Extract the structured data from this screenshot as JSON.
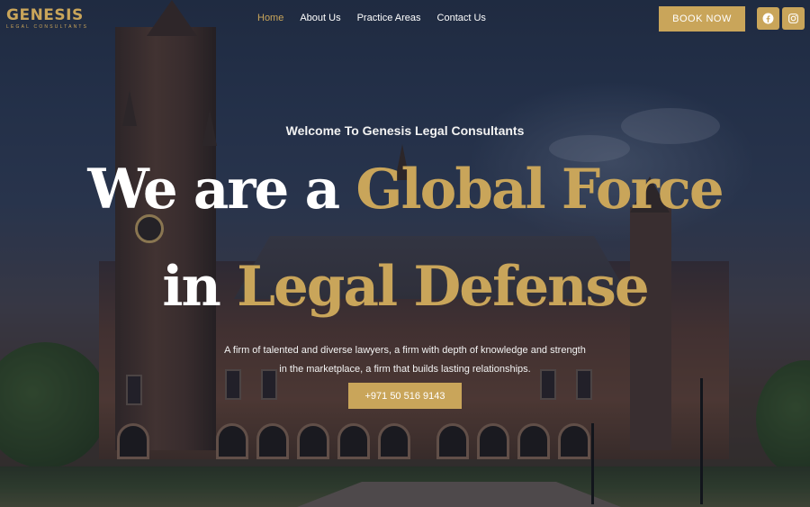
{
  "brand": {
    "logo_text": "GENESIS",
    "logo_subtext": "LEGAL CONSULTANTS",
    "accent_color": "#c9a55a"
  },
  "nav": {
    "items": [
      {
        "label": "Home",
        "active": true
      },
      {
        "label": "About Us",
        "active": false
      },
      {
        "label": "Practice Areas",
        "active": false
      },
      {
        "label": "Contact Us",
        "active": false
      }
    ]
  },
  "header": {
    "book_button_label": "BOOK NOW",
    "social": [
      {
        "icon": "facebook-icon"
      },
      {
        "icon": "instagram-icon"
      }
    ]
  },
  "hero": {
    "welcome": "Welcome To Genesis Legal Consultants",
    "headline_line1_white": "We are a ",
    "headline_line1_gold": "Global Force",
    "headline_line2_white": "in ",
    "headline_line2_gold": "Legal Defense",
    "description_line1": "A firm of talented and diverse lawyers, a firm with depth of knowledge and strength",
    "description_line2": "in the marketplace, a firm that builds lasting relationships.",
    "phone_button_label": "+971 50 516 9143"
  }
}
